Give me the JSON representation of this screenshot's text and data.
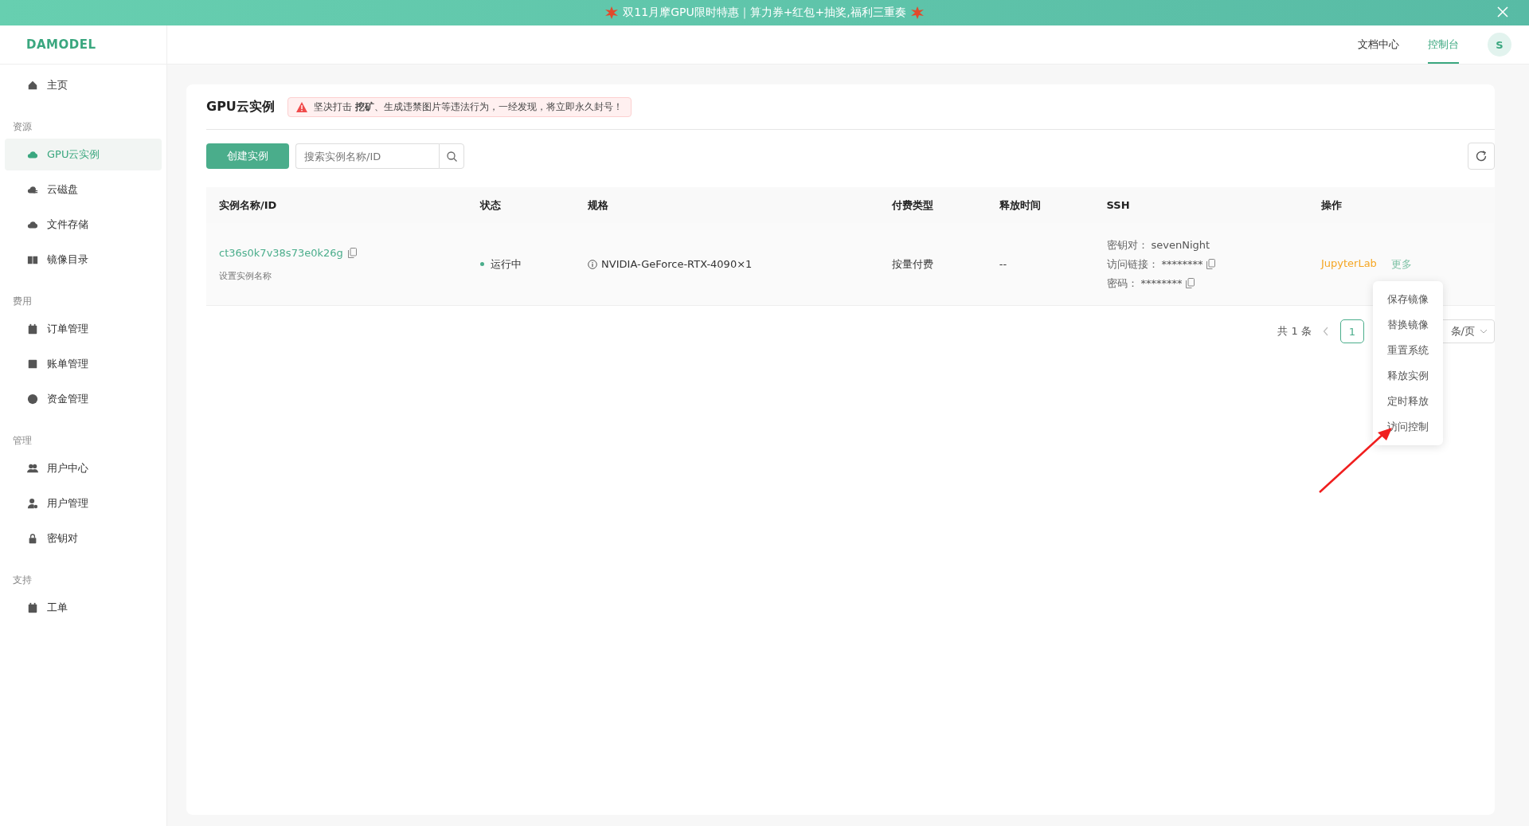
{
  "banner": {
    "text": "双11月摩GPU限时特惠｜算力券+红包+抽奖,福利三重奏"
  },
  "header": {
    "logo": "DAMODEL",
    "links": [
      {
        "label": "文档中心",
        "selected": false
      },
      {
        "label": "控制台",
        "selected": true
      }
    ],
    "avatar": "S"
  },
  "sidebar": {
    "sections": [
      {
        "items": [
          {
            "label": "主页",
            "selected": false
          }
        ]
      },
      {
        "title": "资源",
        "items": [
          {
            "label": "GPU云实例",
            "selected": true
          },
          {
            "label": "云磁盘",
            "selected": false
          },
          {
            "label": "文件存储",
            "selected": false
          },
          {
            "label": "镜像目录",
            "selected": false
          }
        ]
      },
      {
        "title": "费用",
        "items": [
          {
            "label": "订单管理",
            "selected": false
          },
          {
            "label": "账单管理",
            "selected": false
          },
          {
            "label": "资金管理",
            "selected": false
          }
        ]
      },
      {
        "title": "管理",
        "items": [
          {
            "label": "用户中心",
            "selected": false
          },
          {
            "label": "用户管理",
            "selected": false
          },
          {
            "label": "密钥对",
            "selected": false
          }
        ]
      },
      {
        "title": "支持",
        "items": [
          {
            "label": "工单",
            "selected": false
          }
        ]
      }
    ]
  },
  "page": {
    "title": "GPU云实例",
    "notice": "坚决打击 **挖矿**、生成违禁图片等违法行为，一经发现，将立即永久封号！",
    "create_button": "创建实例",
    "search": {
      "placeholder": "搜索实例名称/ID"
    }
  },
  "table": {
    "columns": [
      "实例名称/ID",
      "状态",
      "规格",
      "付费类型",
      "释放时间",
      "SSH",
      "操作"
    ],
    "rows": [
      {
        "id": "ct36s0k7v38s73e0k26g",
        "name_hint": "设置实例名称",
        "status": "运行中",
        "spec": "NVIDIA-GeForce-RTX-4090×1",
        "billing": "按量付费",
        "release": "--",
        "ssh": [
          {
            "label": "密钥对：",
            "value": "sevenNight",
            "copy": false
          },
          {
            "label": "访问链接：",
            "value": "********",
            "copy": true
          },
          {
            "label": "密码：",
            "value": "********",
            "copy": true
          }
        ],
        "actions": [
          "JupyterLab",
          "更多"
        ]
      }
    ]
  },
  "pagination": {
    "total": "共 1 条",
    "pages": [
      {
        "label": "1",
        "selected": true
      }
    ],
    "page_size": "条/页"
  },
  "menu": {
    "items": [
      "保存镜像",
      "替换镜像",
      "重置系统",
      "释放实例",
      "定时释放",
      "访问控制"
    ]
  }
}
